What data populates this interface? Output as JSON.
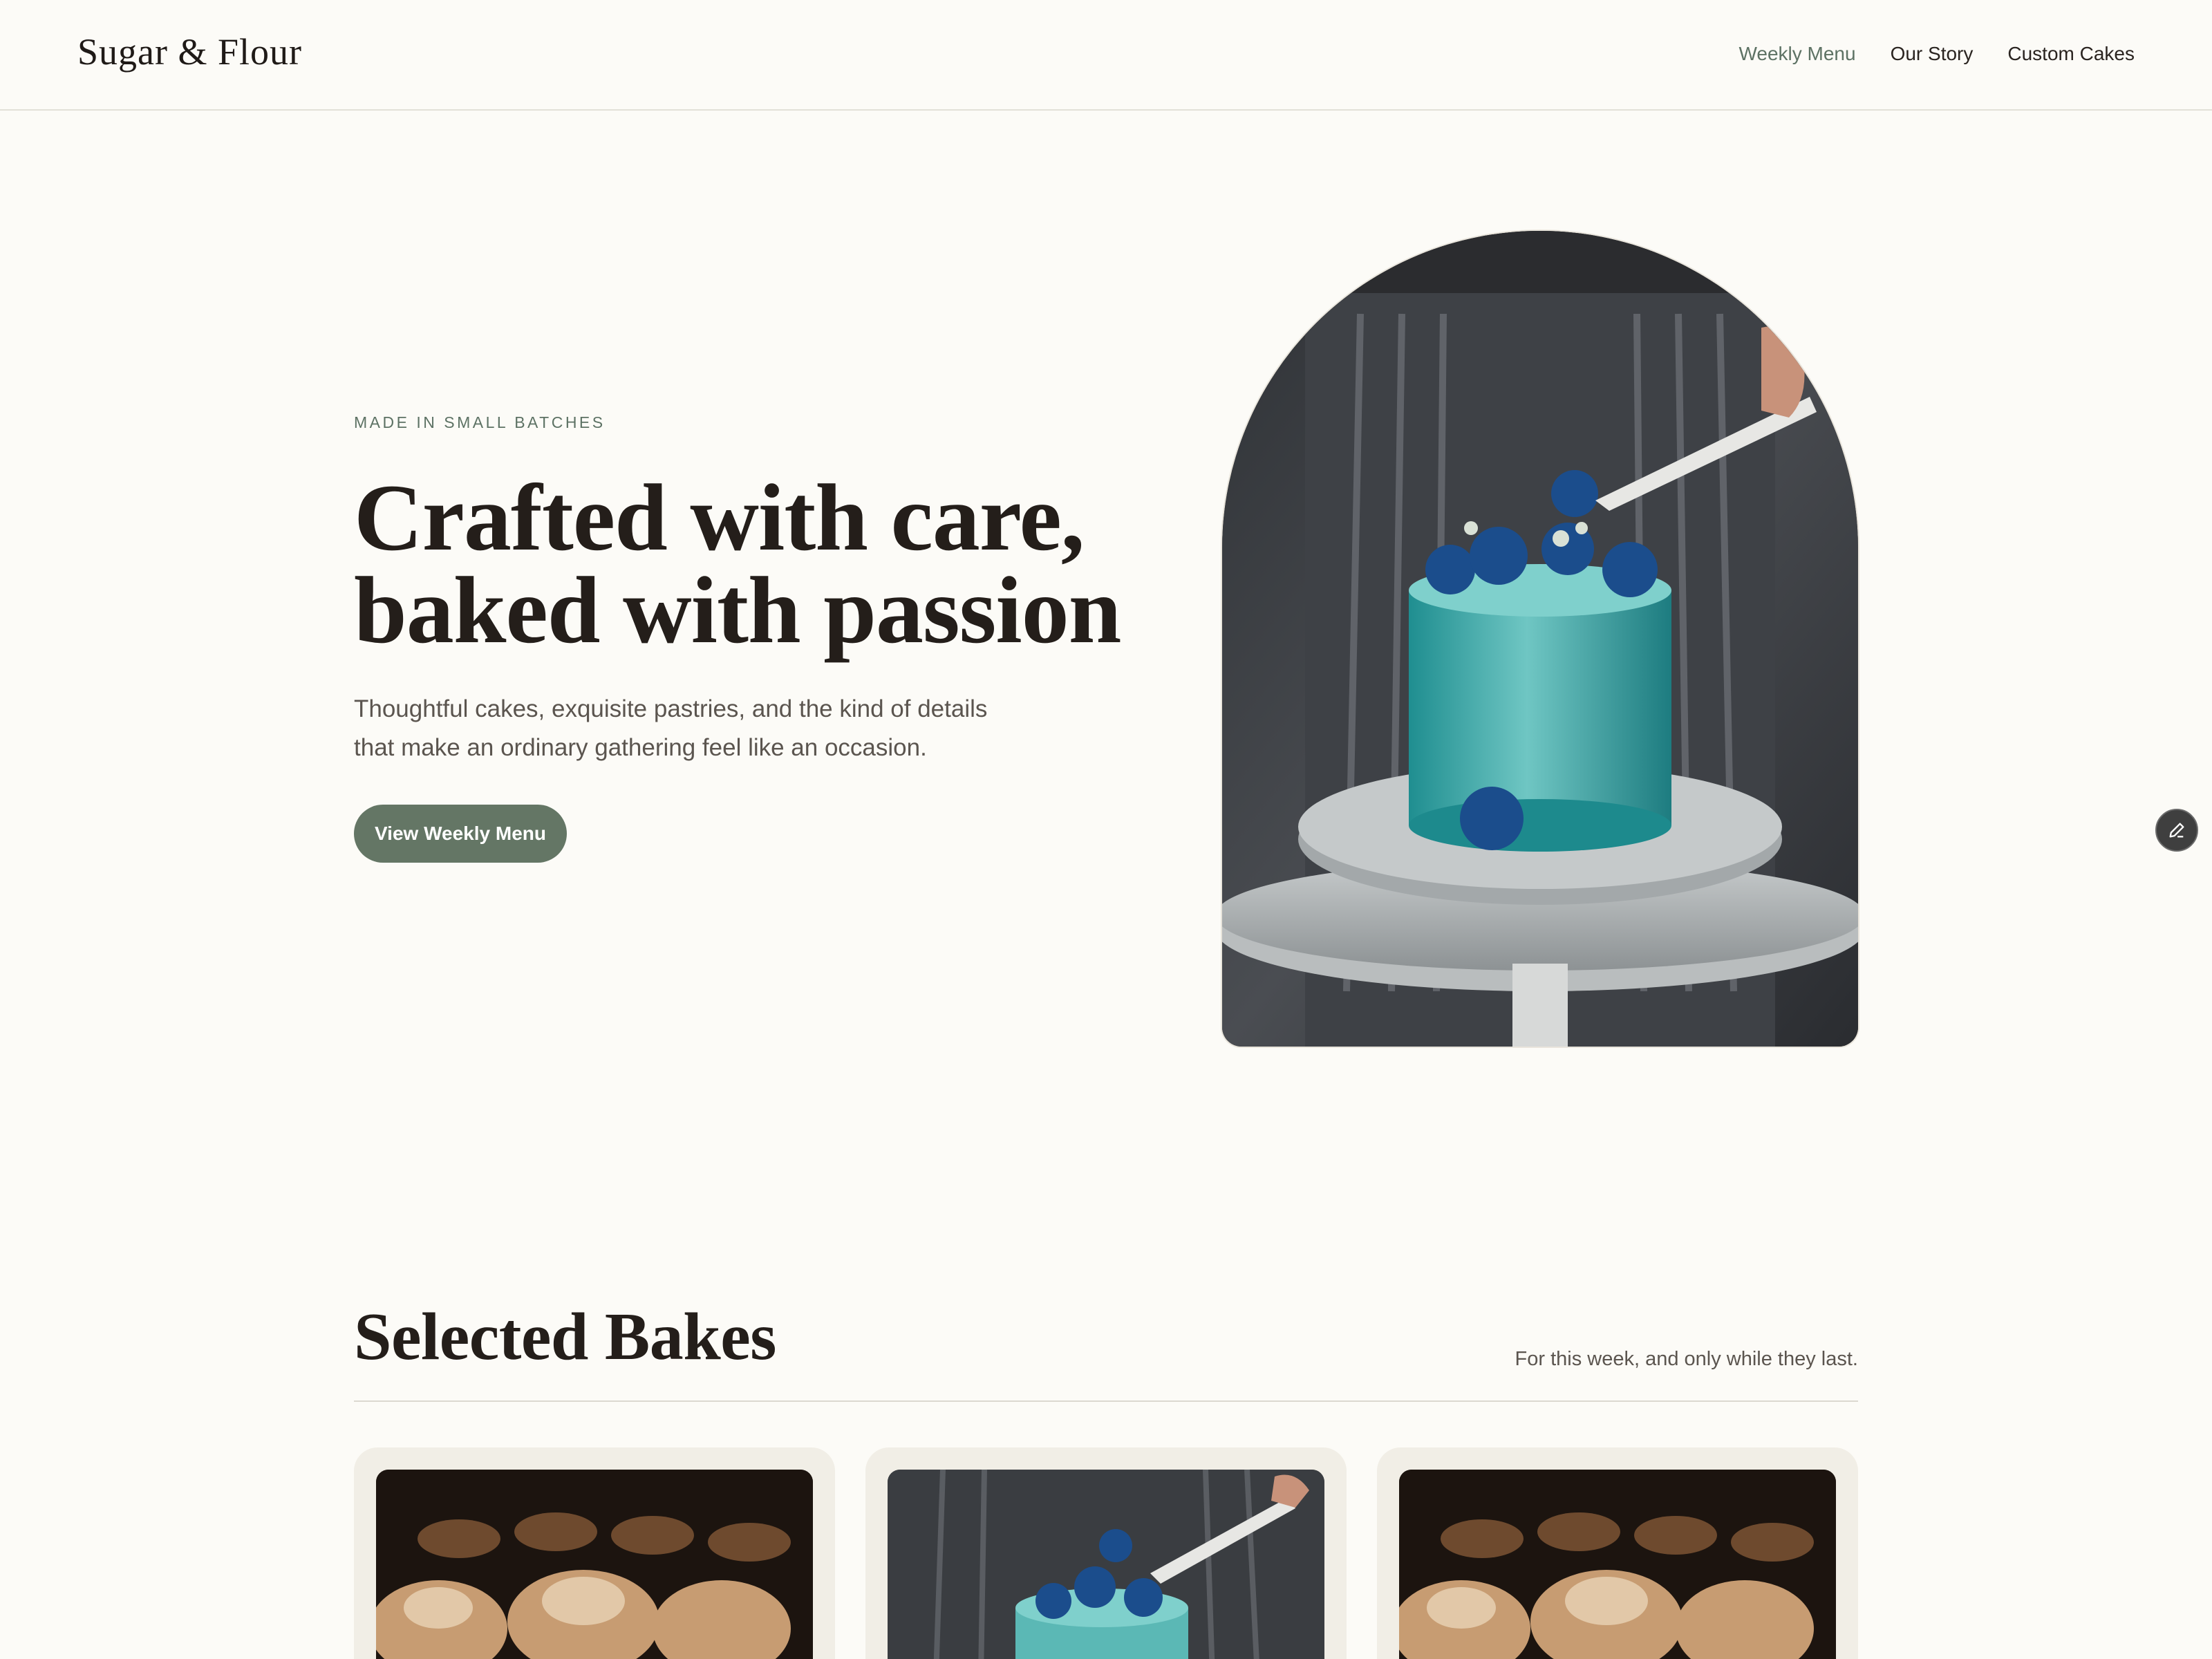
{
  "header": {
    "brand": "Sugar & Flour",
    "nav": [
      {
        "label": "Weekly Menu",
        "active": true
      },
      {
        "label": "Our Story",
        "active": false
      },
      {
        "label": "Custom Cakes",
        "active": false
      }
    ]
  },
  "hero": {
    "eyebrow": "MADE IN SMALL BATCHES",
    "title_line1": "Crafted with care,",
    "title_line2": "baked with passion",
    "subtitle": "Thoughtful cakes, exquisite pastries, and the kind of details that make an ordinary gathering feel like an occasion.",
    "cta_label": "View Weekly Menu"
  },
  "bakes": {
    "title": "Selected Bakes",
    "note": "For this week, and only while they last."
  },
  "icons": {
    "edit": "pencil-icon"
  },
  "colors": {
    "accent": "#647665",
    "accent_text": "#5d7264",
    "background": "#fcfbf7",
    "card": "#f1eee6"
  }
}
